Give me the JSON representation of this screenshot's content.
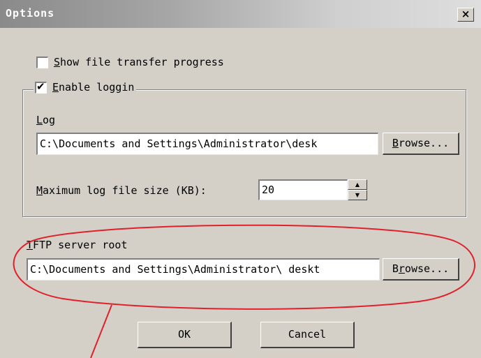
{
  "window": {
    "title": "Options",
    "close_glyph": "×"
  },
  "options": {
    "show_progress_label": "Show file transfer progress",
    "show_progress_checked": false,
    "enable_logging_label": "Enable loggin",
    "enable_logging_checked": true,
    "check_glyph": "✔"
  },
  "log": {
    "label": "Log",
    "path_value": "C:\\Documents and Settings\\Administrator\\desk",
    "browse_label": "Browse...",
    "max_size_label": "Maximum log file size (KB):",
    "max_size_value": "20",
    "spin_up_glyph": "▲",
    "spin_down_glyph": "▼"
  },
  "tftp": {
    "label": "TFTP server root",
    "path_value": "C:\\Documents and Settings\\Administrator\\ deskt",
    "browse_label": "Browse..."
  },
  "footer": {
    "ok_label": "OK",
    "cancel_label": "Cancel"
  },
  "annotation": {
    "color": "#e0202a"
  }
}
